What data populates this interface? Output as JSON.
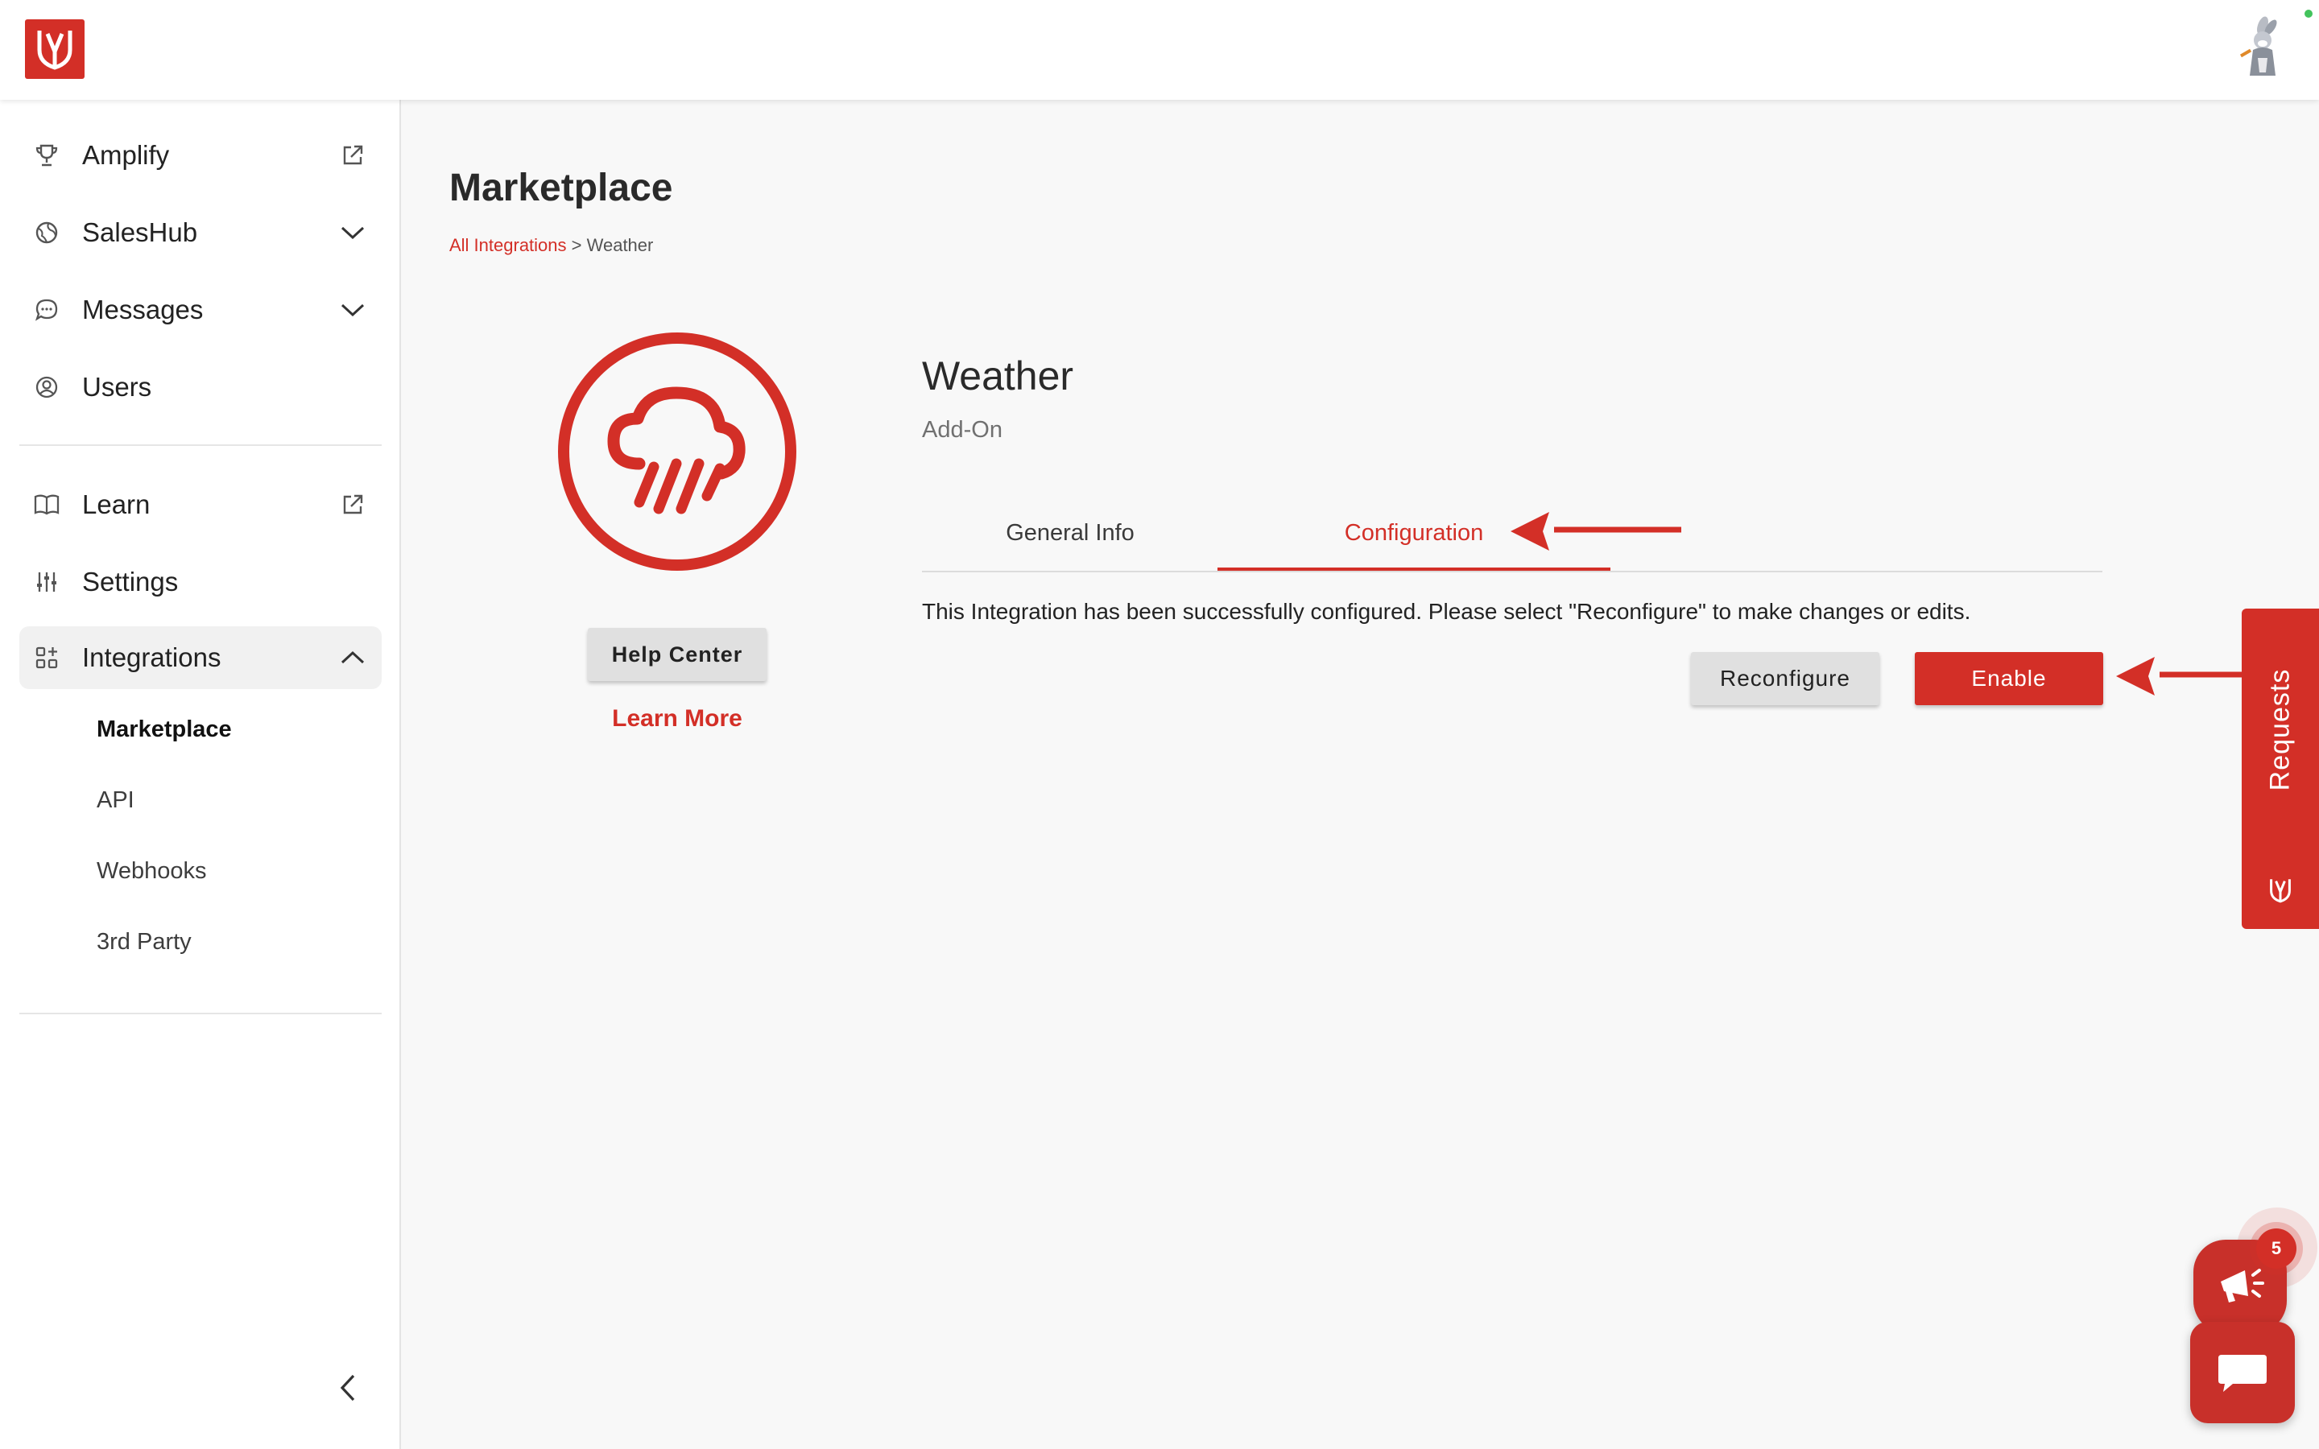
{
  "sidebar": {
    "items": [
      {
        "label": "Amplify",
        "icon": "trophy-icon",
        "right": "external-link-icon"
      },
      {
        "label": "SalesHub",
        "icon": "globe-icon",
        "right": "chevron-down-icon"
      },
      {
        "label": "Messages",
        "icon": "chat-bubble-icon",
        "right": "chevron-down-icon"
      },
      {
        "label": "Users",
        "icon": "user-circle-icon",
        "right": ""
      },
      {
        "label": "Learn",
        "icon": "book-icon",
        "right": "external-link-icon"
      },
      {
        "label": "Settings",
        "icon": "sliders-icon",
        "right": ""
      },
      {
        "label": "Integrations",
        "icon": "grid-icon",
        "right": "chevron-up-icon"
      }
    ],
    "sub_items": [
      "Marketplace",
      "API",
      "Webhooks",
      "3rd Party"
    ]
  },
  "main": {
    "page_title": "Marketplace",
    "breadcrumb": {
      "link": "All Integrations",
      "separator": " > ",
      "current": "Weather"
    },
    "help_center_label": "Help Center",
    "learn_more_label": "Learn More",
    "integration": {
      "title": "Weather",
      "subtitle": "Add-On"
    },
    "tabs": [
      {
        "label": "General Info",
        "active": false
      },
      {
        "label": "Configuration",
        "active": true
      }
    ],
    "status_message": "This Integration has been successfully configured. Please select \"Reconfigure\" to make changes or edits.",
    "reconfigure_label": "Reconfigure",
    "enable_label": "Enable"
  },
  "requests_tab": {
    "label": "Requests"
  },
  "notifications": {
    "count": "5"
  },
  "colors": {
    "brand": "#d32f27",
    "text": "#2a2a2a",
    "background": "#f8f8f8"
  }
}
